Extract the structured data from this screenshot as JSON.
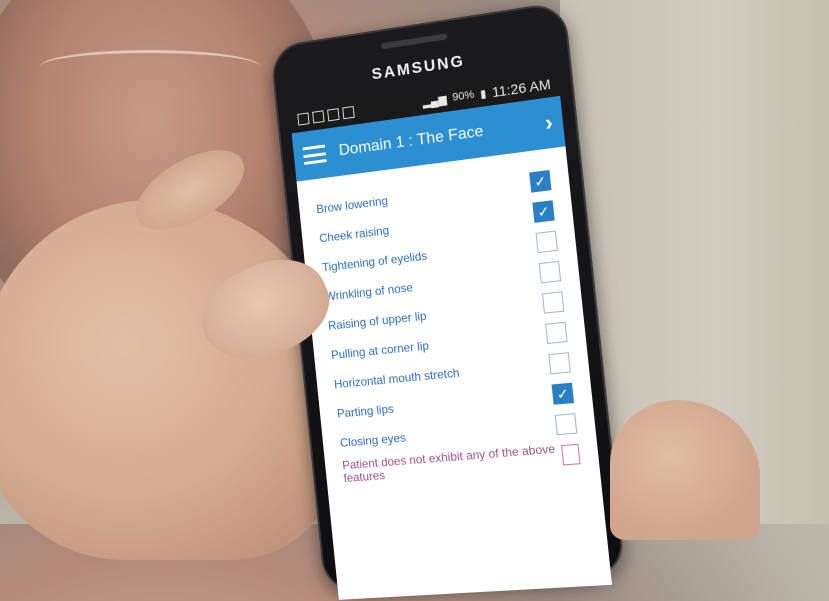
{
  "device": {
    "brand": "SAMSUNG"
  },
  "statusbar": {
    "signal": "90%",
    "time": "11:26 AM"
  },
  "appbar": {
    "title": "Domain 1 : The Face",
    "next_icon": "chevron-right-icon",
    "menu_icon": "hamburger-menu-icon"
  },
  "items": [
    {
      "label": "Brow lowering",
      "checked": true
    },
    {
      "label": "Cheek raising",
      "checked": true
    },
    {
      "label": "Tightening of eyelids",
      "checked": false
    },
    {
      "label": "Wrinkling of nose",
      "checked": false
    },
    {
      "label": "Raising of upper lip",
      "checked": false
    },
    {
      "label": "Pulling at corner lip",
      "checked": false
    },
    {
      "label": "Horizontal mouth stretch",
      "checked": false
    },
    {
      "label": "Parting lips",
      "checked": true
    },
    {
      "label": "Closing eyes",
      "checked": false
    },
    {
      "label": "Patient does not exhibit any of the above features",
      "checked": false
    }
  ],
  "colors": {
    "appbar": "#2b8fd2",
    "checkbox_checked": "#2b7fc4",
    "label": "#2c6cb3",
    "none_label": "#9d4f8e"
  }
}
